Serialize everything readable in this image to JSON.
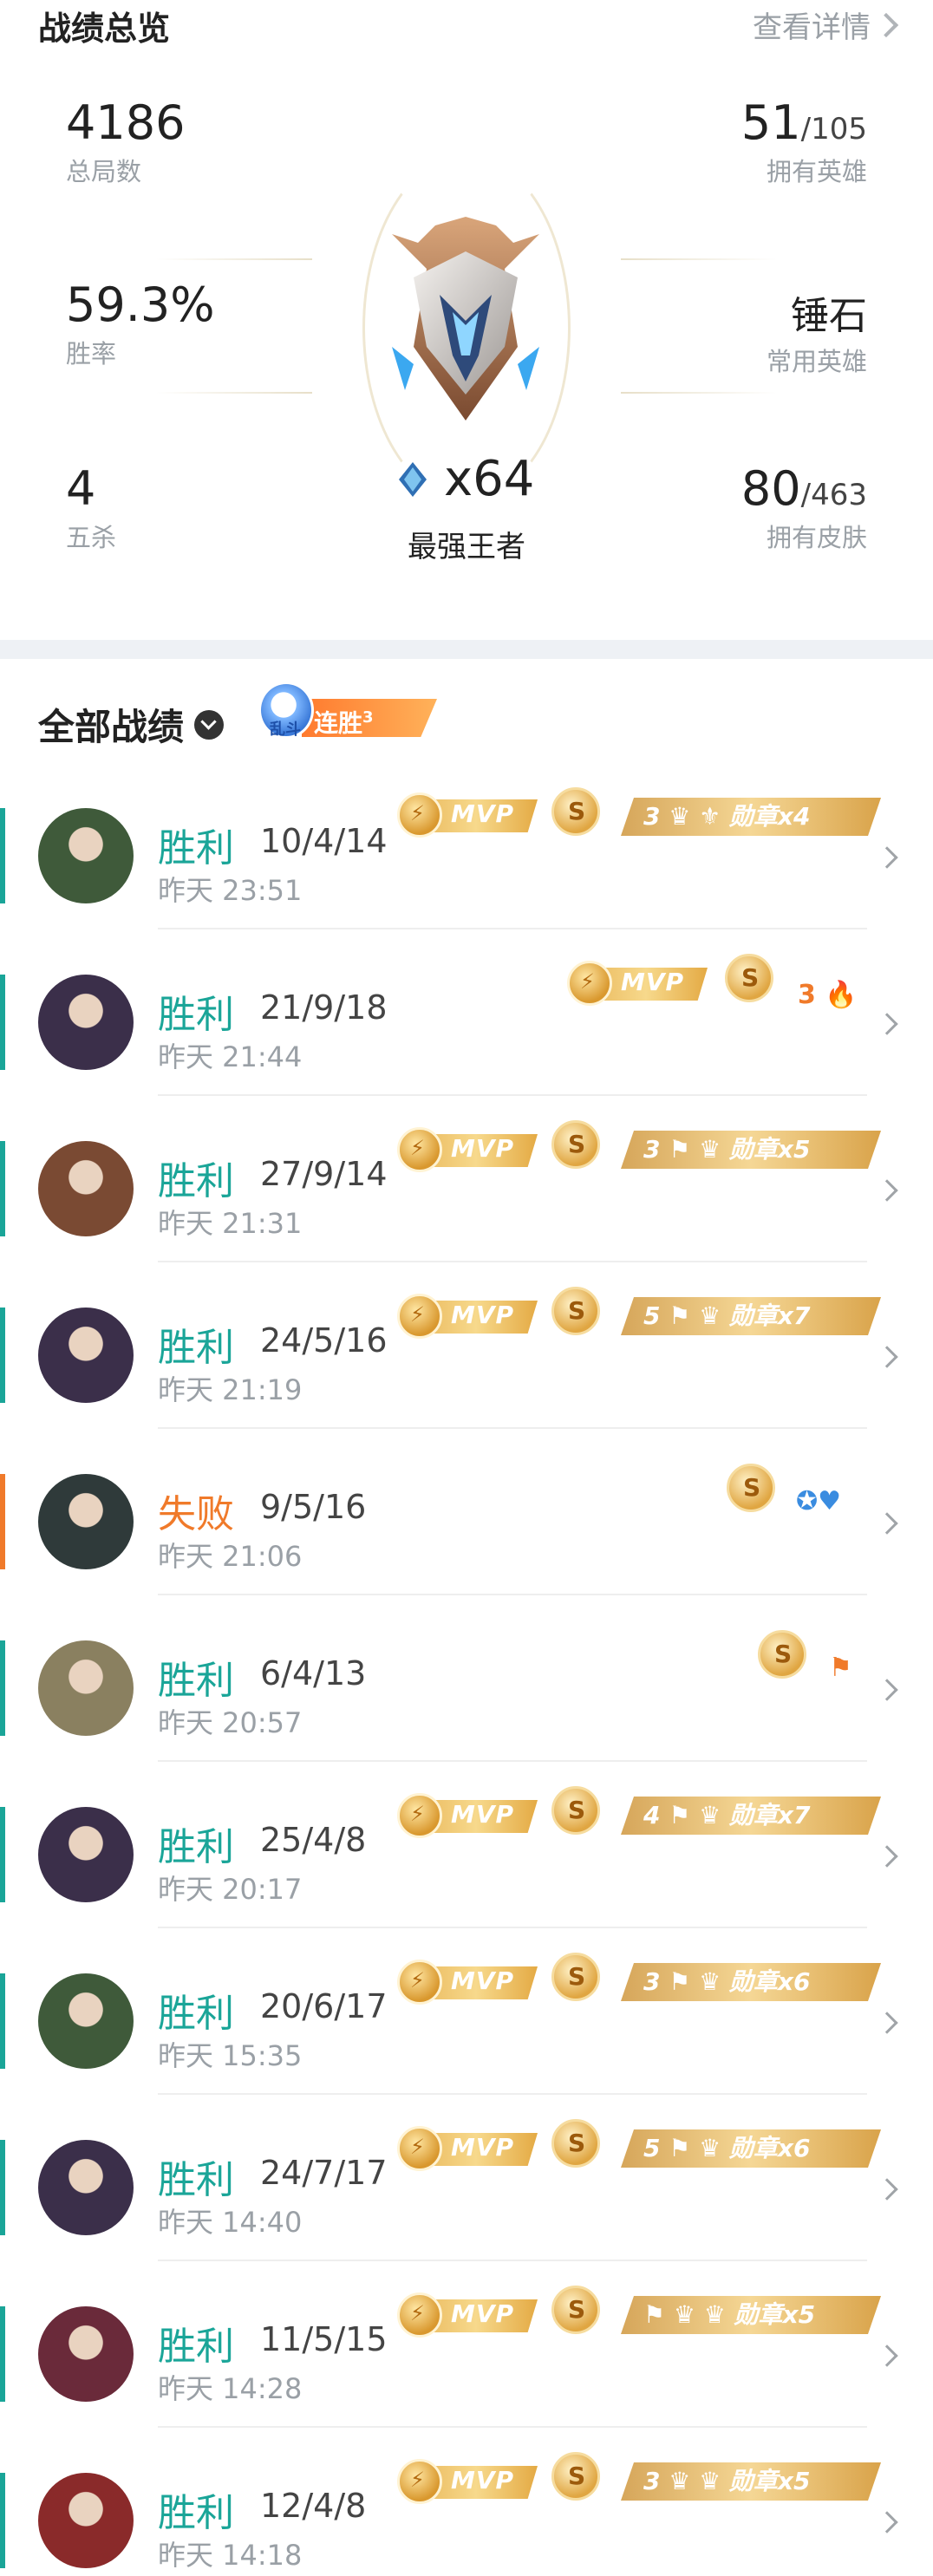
{
  "overview": {
    "title": "战绩总览",
    "detail_link": "查看详情",
    "total_games": {
      "value": "4186",
      "label": "总局数"
    },
    "heroes_owned": {
      "value": "51",
      "total": "/105",
      "label": "拥有英雄"
    },
    "win_rate": {
      "value": "59.3%",
      "label": "胜率"
    },
    "common_hero": {
      "value": "锤石",
      "label": "常用英雄"
    },
    "penta_kills": {
      "value": "4",
      "label": "五杀"
    },
    "skins_owned": {
      "value": "80",
      "total": "/463",
      "label": "拥有皮肤"
    },
    "rank": {
      "stars": "x64",
      "name": "最强王者"
    }
  },
  "records": {
    "title": "全部战绩",
    "streak_badge": {
      "mode": "乱斗",
      "text": "连胜",
      "count": "3"
    },
    "items": [
      {
        "result": "胜利",
        "outcome": "win",
        "kda": "10/4/14",
        "time": "昨天 23:51",
        "mvp": "MVP",
        "s": "S",
        "medal": "3 ♛ ⚜ 勋章x4",
        "avatar_color": "#3f5a3a"
      },
      {
        "result": "胜利",
        "outcome": "win",
        "kda": "21/9/18",
        "time": "昨天 21:44",
        "mvp": "MVP",
        "s": "S",
        "medal": "3 🔥",
        "avatar_color": "#3b2f4a"
      },
      {
        "result": "胜利",
        "outcome": "win",
        "kda": "27/9/14",
        "time": "昨天 21:31",
        "mvp": "MVP",
        "s": "S",
        "medal": "3 ⚑ ♛ 勋章x5",
        "avatar_color": "#7a4a33"
      },
      {
        "result": "胜利",
        "outcome": "win",
        "kda": "24/5/16",
        "time": "昨天 21:19",
        "mvp": "MVP",
        "s": "S",
        "medal": "5 ⚑ ♛ 勋章x7",
        "avatar_color": "#3b2f4a"
      },
      {
        "result": "失败",
        "outcome": "loss",
        "kda": "9/5/16",
        "time": "昨天 21:06",
        "mvp": "",
        "s": "S",
        "medal": "",
        "avatar_color": "#2f3a3a"
      },
      {
        "result": "胜利",
        "outcome": "win",
        "kda": "6/4/13",
        "time": "昨天 20:57",
        "mvp": "",
        "s": "S",
        "medal": "",
        "avatar_color": "#8a8060"
      },
      {
        "result": "胜利",
        "outcome": "win",
        "kda": "25/4/8",
        "time": "昨天 20:17",
        "mvp": "MVP",
        "s": "S",
        "medal": "4 ⚑ ♛ 勋章x7",
        "avatar_color": "#3b2f4a"
      },
      {
        "result": "胜利",
        "outcome": "win",
        "kda": "20/6/17",
        "time": "昨天 15:35",
        "mvp": "MVP",
        "s": "S",
        "medal": "3 ⚑ ♛ 勋章x6",
        "avatar_color": "#3f5a3a"
      },
      {
        "result": "胜利",
        "outcome": "win",
        "kda": "24/7/17",
        "time": "昨天 14:40",
        "mvp": "MVP",
        "s": "S",
        "medal": "5 ⚑ ♛ 勋章x6",
        "avatar_color": "#3b2f4a"
      },
      {
        "result": "胜利",
        "outcome": "win",
        "kda": "11/5/15",
        "time": "昨天 14:28",
        "mvp": "MVP",
        "s": "S",
        "medal": "⚑ ♛ ♛ 勋章x5",
        "avatar_color": "#6a2a3a"
      },
      {
        "result": "胜利",
        "outcome": "win",
        "kda": "12/4/8",
        "time": "昨天 14:18",
        "mvp": "MVP",
        "s": "S",
        "medal": "3 ♛ ♛ 勋章x5",
        "avatar_color": "#8a2a2a"
      }
    ]
  },
  "colors": {
    "win": "#1aa598",
    "loss": "#f07a2a",
    "gold": "#e6b35a"
  }
}
